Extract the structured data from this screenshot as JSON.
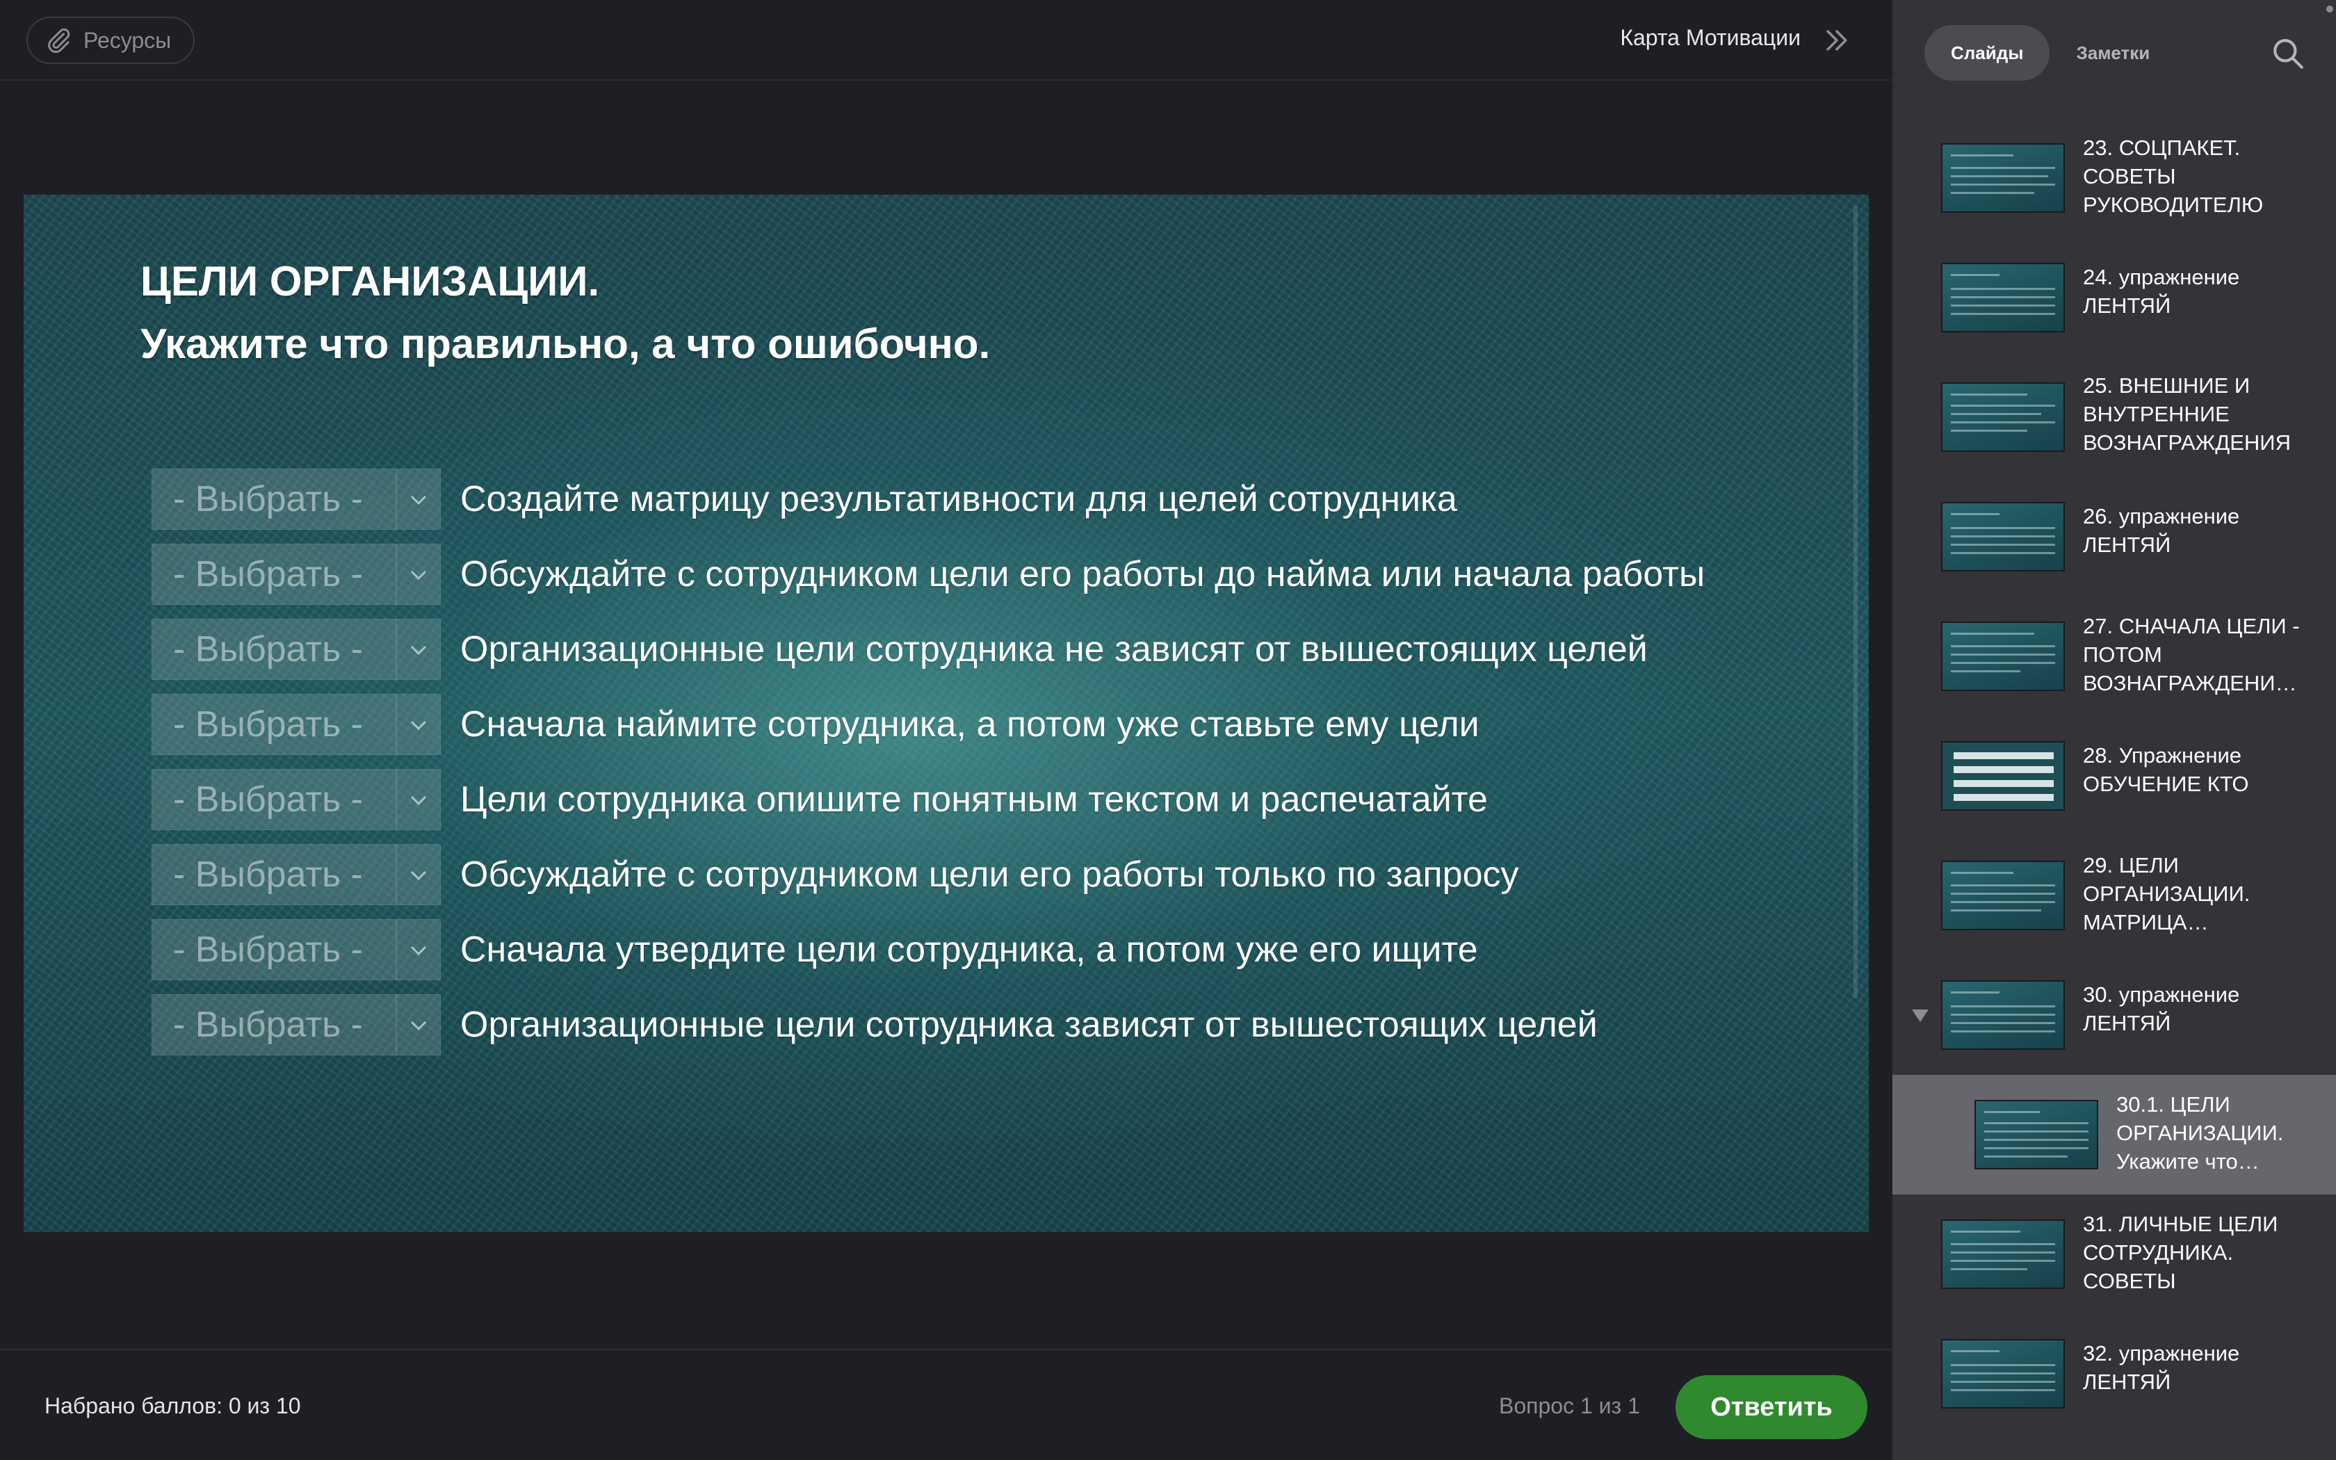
{
  "header": {
    "resources_label": "Ресурсы",
    "course_title": "Карта Мотивации"
  },
  "slide": {
    "title": "ЦЕЛИ ОРГАНИЗАЦИИ.",
    "subtitle": "Укажите что правильно, а что ошибочно.",
    "select_placeholder": "- Выбрать -",
    "statements": [
      "Создайте матрицу результативности для целей сотрудника",
      "Обсуждайте с сотрудником цели его работы до найма или начала работы",
      "Организационные цели сотрудника не зависят от вышестоящих целей",
      "Сначала наймите сотрудника, а потом уже ставьте ему цели",
      "Цели сотрудника опишите понятным текстом и распечатайте",
      "Обсуждайте с сотрудником цели его работы только по запросу",
      "Сначала утвердите цели сотрудника, а потом уже его ищите",
      "Организационные цели сотрудника зависят от вышестоящих целей"
    ]
  },
  "footer": {
    "score": "Набрано баллов: 0 из 10",
    "question_counter": "Вопрос 1 из 1",
    "submit_label": "Ответить"
  },
  "sidebar": {
    "tabs": [
      {
        "label": "Слайды",
        "active": true
      },
      {
        "label": "Заметки",
        "active": false
      }
    ],
    "items": [
      {
        "label": "23. СОЦПАКЕТ. СОВЕТЫ РУКОВОДИТЕЛЮ"
      },
      {
        "label": "24. упражнение ЛЕНТЯЙ"
      },
      {
        "label": "25. ВНЕШНИЕ И ВНУТРЕННИЕ ВОЗНАГРАЖДЕНИЯ"
      },
      {
        "label": "26. упражнение ЛЕНТЯЙ"
      },
      {
        "label": "27. СНАЧАЛА ЦЕЛИ - ПОТОМ ВОЗНАГРАЖДЕНИ…"
      },
      {
        "label": "28. Упражнение ОБУЧЕНИЕ КТО"
      },
      {
        "label": "29. ЦЕЛИ ОРГАНИЗАЦИИ. МАТРИЦА…"
      },
      {
        "label": "30. упражнение ЛЕНТЯЙ"
      },
      {
        "label": "30.1. ЦЕЛИ ОРГАНИЗАЦИИ. Укажите что…"
      },
      {
        "label": "31. ЛИЧНЫЕ ЦЕЛИ СОТРУДНИКА. СОВЕТЫ"
      },
      {
        "label": "32. упражнение ЛЕНТЯЙ"
      }
    ]
  },
  "colors": {
    "accent_green": "#2f8a2f",
    "sidebar_bg": "#333338",
    "main_bg": "#1e1f24",
    "active_item_bg": "#66676c"
  },
  "icons": {
    "resources": "paperclip-icon",
    "expand": "double-chevron-right-icon",
    "search": "search-icon",
    "select_arrow": "chevron-down-icon",
    "collapse": "triangle-down-icon"
  }
}
